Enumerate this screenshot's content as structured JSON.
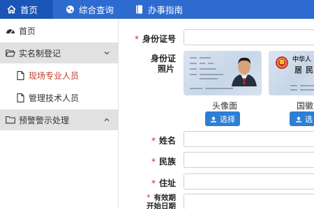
{
  "topnav": {
    "items": [
      {
        "label": "首页",
        "icon": "home-icon"
      },
      {
        "label": "综合查询",
        "icon": "globe-icon"
      },
      {
        "label": "办事指南",
        "icon": "book-icon"
      }
    ]
  },
  "sidebar": {
    "home": "首页",
    "group1": "实名制登记",
    "sub1": "现场专业人员",
    "sub2": "管理技术人员",
    "group2": "预警警示处理"
  },
  "form": {
    "required_mark": "*",
    "id_number_label": "身份证号",
    "id_photo_label_line1": "身份证",
    "id_photo_label_line2": "照片",
    "front_caption": "头像面",
    "back_caption": "国徽面",
    "select_label": "选择",
    "back_select_label": "选",
    "name_label": "姓名",
    "ethnicity_label": "民族",
    "address_label": "住址",
    "valid_start_line1": "有效期",
    "valid_start_line2": "开始日期",
    "card_back_title": "中华人",
    "card_back_sub": "居民"
  },
  "colors": {
    "topbar": "#2e6bd0",
    "accent": "#2d7fd3",
    "required": "#e02020",
    "active_sub": "#c0392b"
  }
}
